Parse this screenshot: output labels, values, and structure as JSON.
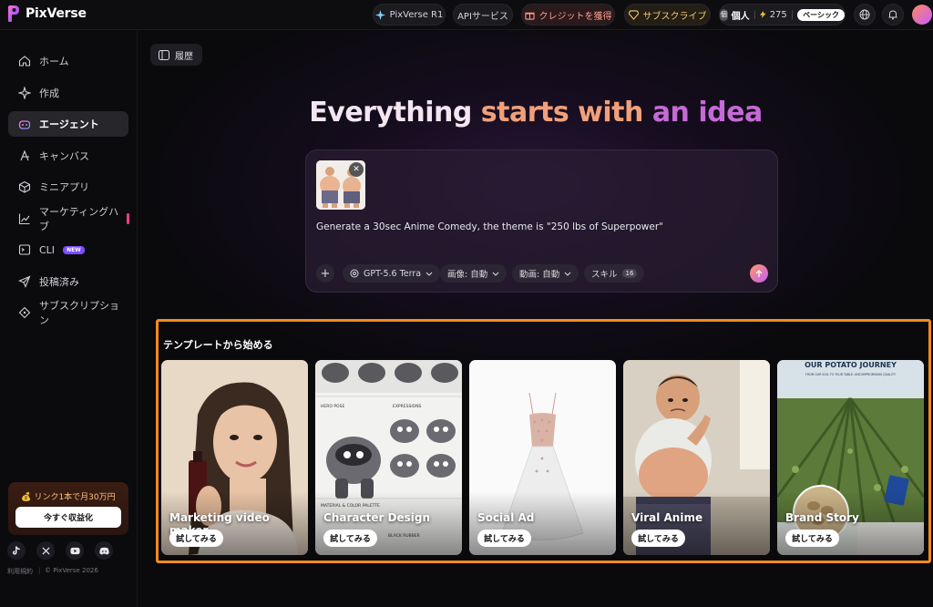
{
  "app": {
    "name": "PixVerse"
  },
  "topbar": {
    "model_pill": "PixVerse R1",
    "api_service": "APIサービス",
    "credits": "クレジットを獲得",
    "subscribe": "サブスクライブ",
    "account_type": "個人",
    "credit_count": "275",
    "plan_badge": "ベーシック",
    "account_initial": "個"
  },
  "sidebar": {
    "items": [
      {
        "label": "ホーム",
        "icon": "home-icon"
      },
      {
        "label": "作成",
        "icon": "sparkle-icon"
      },
      {
        "label": "エージェント",
        "icon": "robot-icon"
      },
      {
        "label": "キャンバス",
        "icon": "canvas-icon"
      },
      {
        "label": "ミニアプリ",
        "icon": "cube-icon"
      },
      {
        "label": "マーケティングハブ",
        "icon": "chart-icon"
      },
      {
        "label": "CLI",
        "icon": "terminal-icon",
        "tag": "NEW"
      },
      {
        "label": "投稿済み",
        "icon": "send-icon"
      },
      {
        "label": "サブスクリプション",
        "icon": "diamond-icon"
      }
    ],
    "promo": {
      "title": "💰 リンク1本で月30万円",
      "button": "今すぐ収益化"
    },
    "footer": {
      "terms": "利用規約",
      "copyright": "© PixVerse 2026"
    }
  },
  "main": {
    "history_label": "履歴",
    "headline": {
      "part1": "Everything ",
      "part2": "starts with ",
      "part3": "an idea"
    },
    "composer": {
      "prompt": "Generate a 30sec Anime Comedy, the theme is \"250 lbs of Superpower\"",
      "model": "GPT-5.6 Terra",
      "image_option": "画像: 自動",
      "video_option": "動画: 自動",
      "skills_label": "スキル",
      "skills_count": "16"
    },
    "templates": {
      "title": "テンプレートから始める",
      "try_label": "試してみる",
      "cards": [
        {
          "label": "Marketing video maker"
        },
        {
          "label": "Character Design"
        },
        {
          "label": "Social Ad"
        },
        {
          "label": "Viral Anime"
        },
        {
          "label": "Brand Story",
          "image_title": "OUR POTATO JOURNEY",
          "image_subtitle": "FROM OUR SOIL TO YOUR TABLE: UNCOMPROMISING QUALITY"
        }
      ],
      "character_sheet": {
        "pose": "HERO POSE",
        "expressions": "EXPRESSIONS",
        "palette": "MATERIAL & COLOR PALETTE",
        "rubber": "BLACK RUBBER"
      }
    }
  },
  "colors": {
    "accent_orange": "#f58a1f",
    "headline_peach": "#f2a07a",
    "headline_purple": "#c56ad6",
    "new_badge": "#7a4dff"
  }
}
